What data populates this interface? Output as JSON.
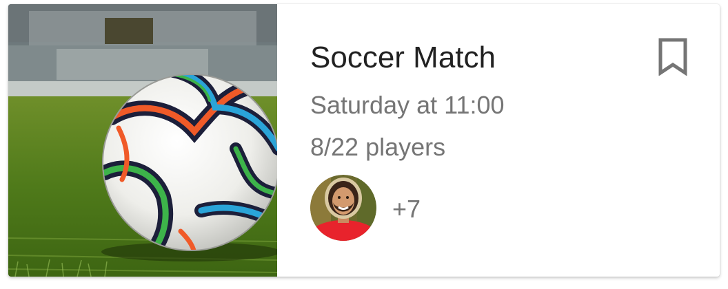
{
  "card": {
    "title": "Soccer Match",
    "schedule": "Saturday at 11:00",
    "players": "8/22 players",
    "more_count": "+7",
    "image_icon": "soccer-ball-photo",
    "bookmark_icon": "bookmark-outline-icon"
  },
  "colors": {
    "title": "#212121",
    "secondary_text": "#757575",
    "card_background": "#ffffff"
  }
}
